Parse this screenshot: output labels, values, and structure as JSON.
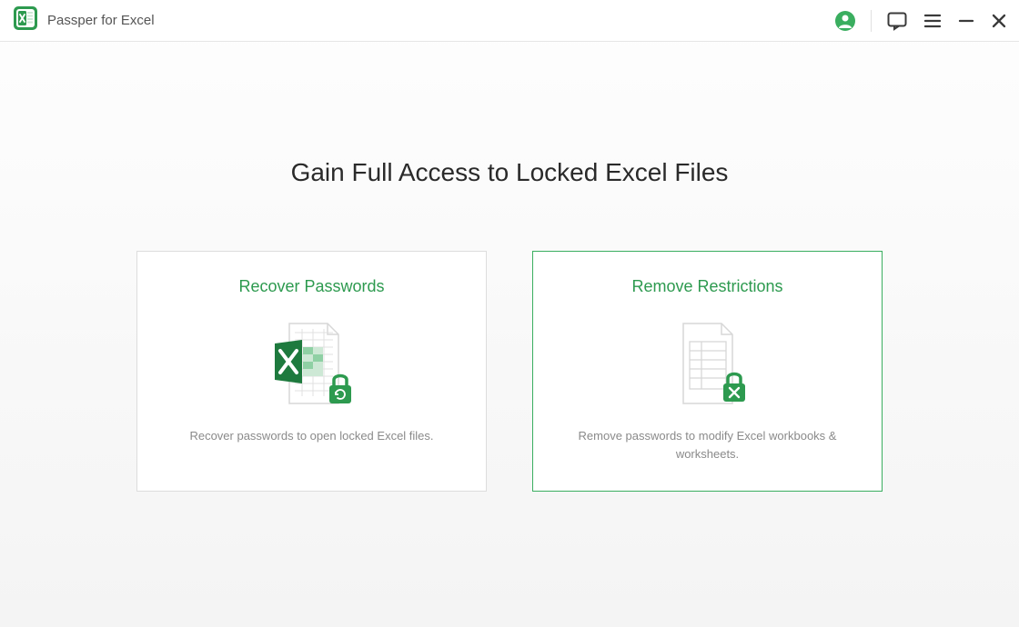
{
  "app": {
    "title": "Passper for Excel"
  },
  "main": {
    "heading": "Gain Full Access to Locked Excel Files"
  },
  "cards": {
    "recover": {
      "title": "Recover Passwords",
      "desc": "Recover passwords to open locked Excel files."
    },
    "remove": {
      "title": "Remove Restrictions",
      "desc": "Remove passwords to modify Excel workbooks & worksheets."
    }
  },
  "colors": {
    "accent": "#3aae5f"
  }
}
